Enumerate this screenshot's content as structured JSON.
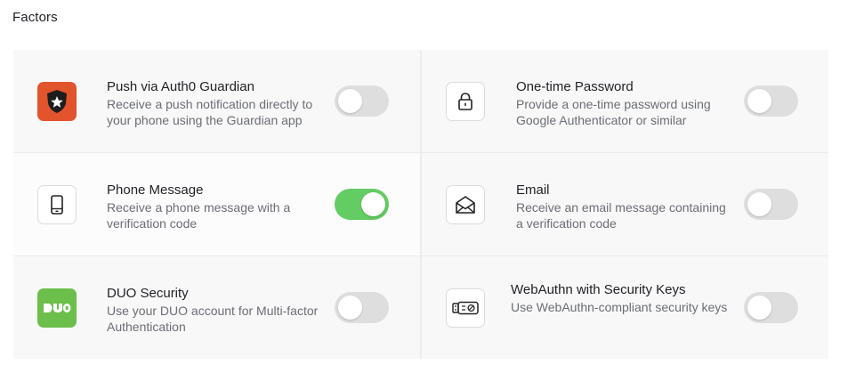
{
  "section": {
    "title": "Factors"
  },
  "colors": {
    "toggle_on": "#63cc63",
    "toggle_off": "#dedede",
    "guardian": "#e2542c",
    "duo": "#6cbf4a"
  },
  "factors": [
    {
      "title": "Push via Auth0 Guardian",
      "description": "Receive a push notification directly to your phone using the Guardian app",
      "icon": "auth0-guardian-icon",
      "enabled": false
    },
    {
      "title": "One-time Password",
      "description": "Provide a one-time password using Google Authenticator or similar",
      "icon": "lock-icon",
      "enabled": false
    },
    {
      "title": "Phone Message",
      "description": "Receive a phone message with a verification code",
      "icon": "phone-icon",
      "enabled": true
    },
    {
      "title": "Email",
      "description": "Receive an email message containing a verification code",
      "icon": "envelope-icon",
      "enabled": false
    },
    {
      "title": "DUO Security",
      "description": "Use your DUO account for Multi-factor Authentication",
      "icon": "duo-icon",
      "enabled": false
    },
    {
      "title": "WebAuthn with Security Keys",
      "description": "Use WebAuthn-compliant security keys",
      "icon": "security-key-icon",
      "enabled": false
    }
  ]
}
